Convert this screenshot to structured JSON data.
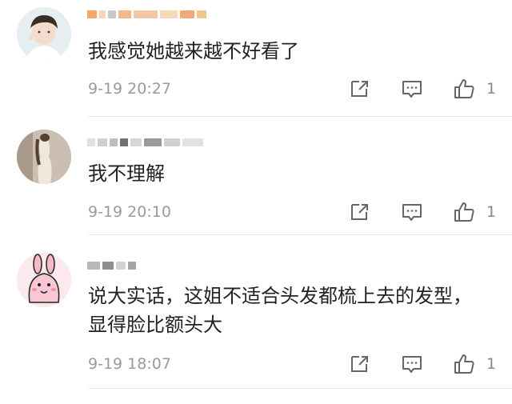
{
  "comments": [
    {
      "text": "我感觉她越来越不好看了",
      "time": "9-19 20:27",
      "likes": "1",
      "username_block_colors": [
        "#f6a86a",
        "#f9d4b8",
        "#c8c8c8",
        "#f0b990",
        "#f3c6a4",
        "#f7d9b3",
        "#f2a878",
        "#f1c58e"
      ]
    },
    {
      "text": "我不理解",
      "time": "9-19 20:10",
      "likes": "1",
      "username_block_colors": [
        "#e0e0e0",
        "#cfcfcf",
        "#bdbdbd",
        "#707070",
        "#d6d6d6",
        "#9a9a9a",
        "#d0d0d0",
        "#e2e2e2"
      ]
    },
    {
      "text": "说大实话，这姐不适合头发都梳上去的发型，显得脸比额头大",
      "time": "9-19 18:07",
      "likes": "1",
      "username_block_colors": [
        "#b8b8b8",
        "#8e8e8e",
        "#d2d2d2",
        "#a4a4a4"
      ]
    }
  ],
  "icons": [
    "share-icon",
    "comment-icon",
    "like-icon"
  ],
  "colors": {
    "meta_gray": "#9a9a9a",
    "divider": "#e8e8e8",
    "text": "#222222"
  }
}
